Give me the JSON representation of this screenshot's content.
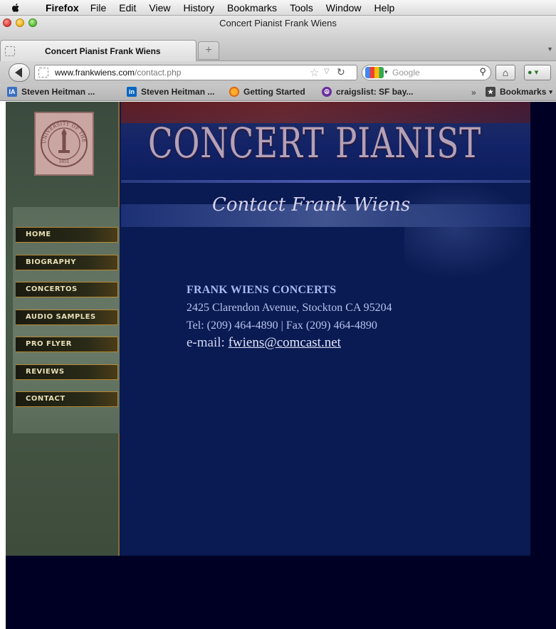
{
  "menubar": {
    "app_name": "Firefox",
    "items": [
      "File",
      "Edit",
      "View",
      "History",
      "Bookmarks",
      "Tools",
      "Window",
      "Help"
    ]
  },
  "window": {
    "title": "Concert Pianist Frank Wiens"
  },
  "tabs": [
    {
      "label": "Concert Pianist Frank Wiens",
      "active": true
    }
  ],
  "new_tab_symbol": "+",
  "navbar": {
    "url_host": "www.frankwiens.com",
    "url_path": "/contact.php",
    "search_placeholder": "Google"
  },
  "bookmarks": {
    "items": [
      {
        "label": "Steven Heitman ...",
        "icon": "ia-icon",
        "icon_text": "IA"
      },
      {
        "label": "Steven Heitman ...",
        "icon": "linkedin-icon",
        "icon_text": "in"
      },
      {
        "label": "Getting Started",
        "icon": "firefox-icon",
        "icon_text": ""
      },
      {
        "label": "craigslist: SF bay...",
        "icon": "peace-icon",
        "icon_text": "☮"
      }
    ],
    "overflow": "»",
    "menu_label": "Bookmarks"
  },
  "site": {
    "banner_title": "CONCERT PIANIST",
    "subtitle": "Contact Frank Wiens",
    "nav": [
      "HOME",
      "BIOGRAPHY",
      "CONCERTOS",
      "AUDIO SAMPLES",
      "PRO FLYER",
      "REVIEWS",
      "CONTACT"
    ],
    "contact": {
      "name": "FRANK WIENS CONCERTS",
      "address": "2425 Clarendon Avenue,  Stockton  CA  95204",
      "phone": "Tel: (209) 464-4890  |  Fax (209) 464-4890",
      "email_label": "e-mail: ",
      "email": "fwiens@comcast.net"
    },
    "seal_text": "UNIVERSITY OF THE PACIFIC",
    "seal_year": "1851"
  },
  "colors": {
    "page_bg": "#000024",
    "site_bg": "#0a1a52",
    "nav_border": "#b38a34",
    "contact_text": "#b8c4ef"
  }
}
